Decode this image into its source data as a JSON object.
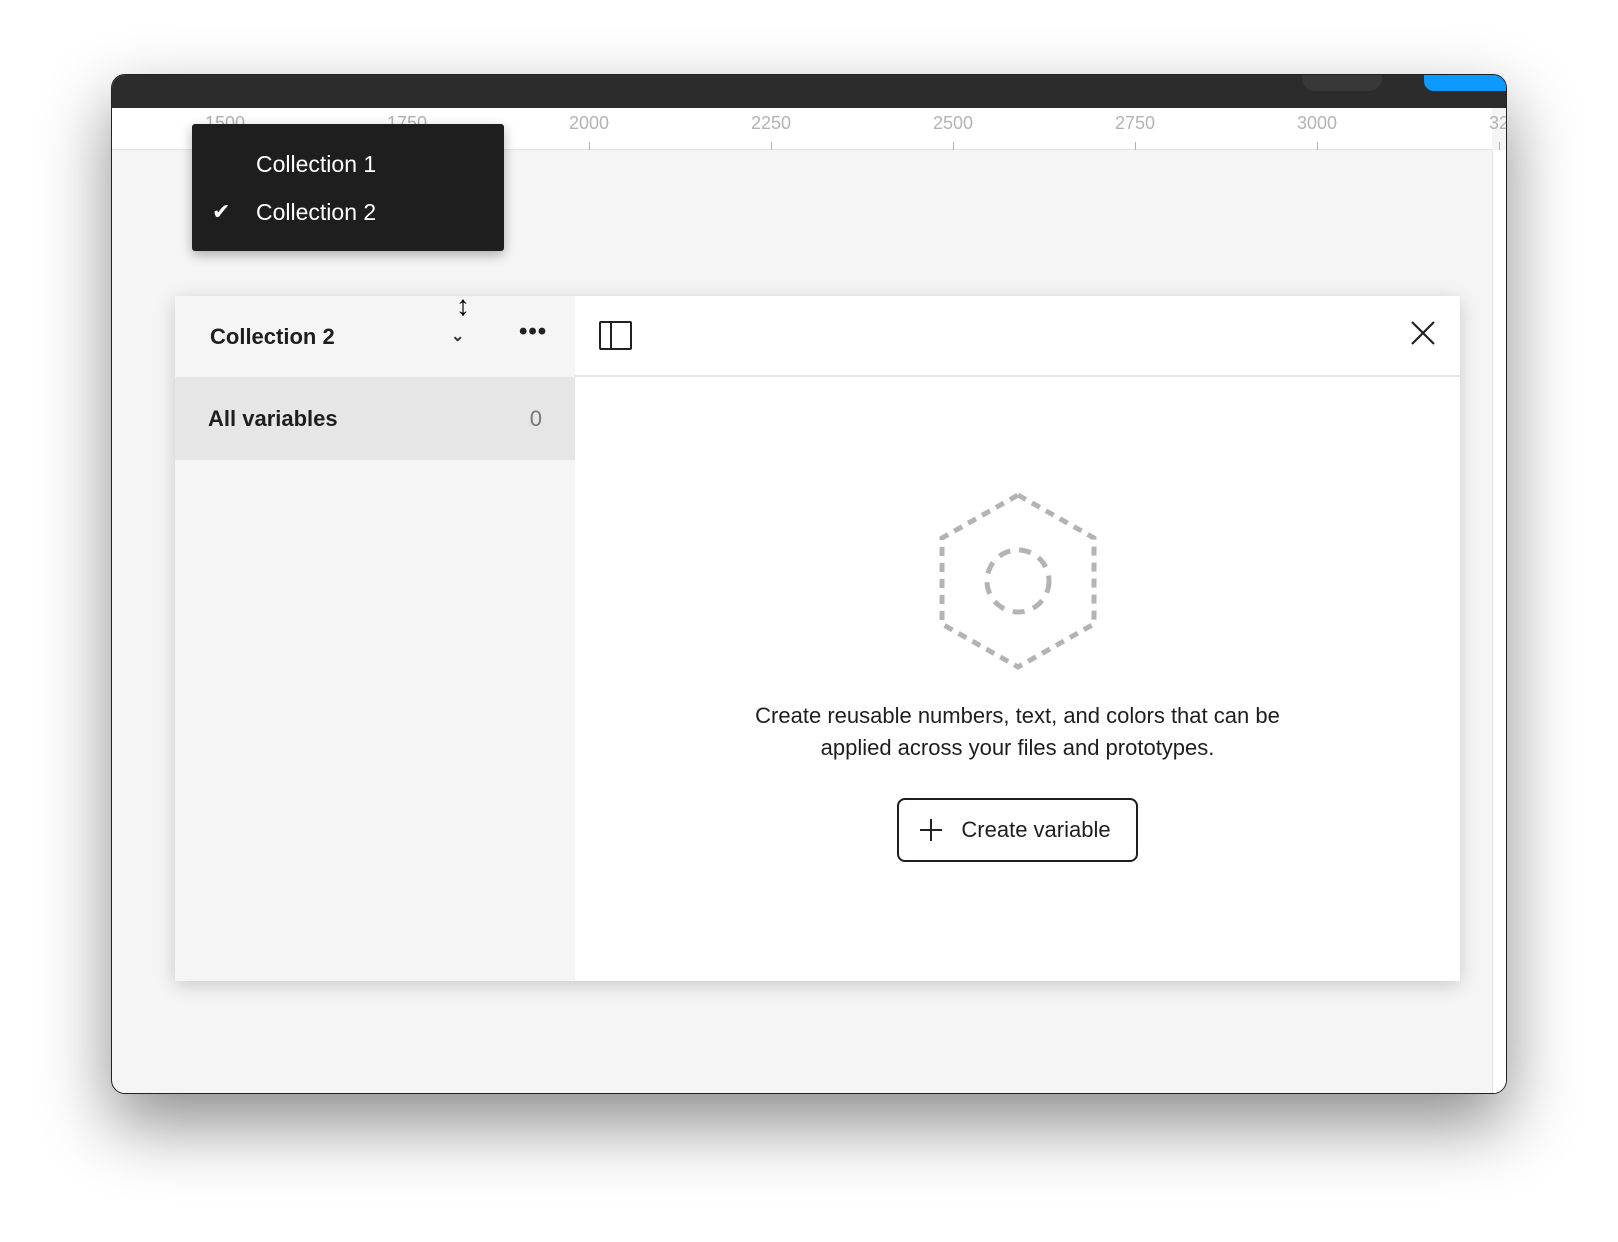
{
  "ruler": {
    "ticks": [
      "1500",
      "1750",
      "2000",
      "2250",
      "2500",
      "2750",
      "3000",
      "32"
    ]
  },
  "dropdown": {
    "items": [
      {
        "label": "Collection 1",
        "selected": false
      },
      {
        "label": "Collection 2",
        "selected": true
      }
    ]
  },
  "panel": {
    "collection_name": "Collection 2",
    "sidebar": {
      "items": [
        {
          "label": "All variables",
          "count": "0"
        }
      ]
    },
    "empty_state": {
      "message_line1": "Create reusable numbers, text, and colors that can be",
      "message_line2": "applied across your files and prototypes.",
      "button_label": "Create variable"
    }
  },
  "colors": {
    "accent": "#0d99ff",
    "menu_bg": "#1e1e1e",
    "selected_row": "#e6e6e6"
  }
}
